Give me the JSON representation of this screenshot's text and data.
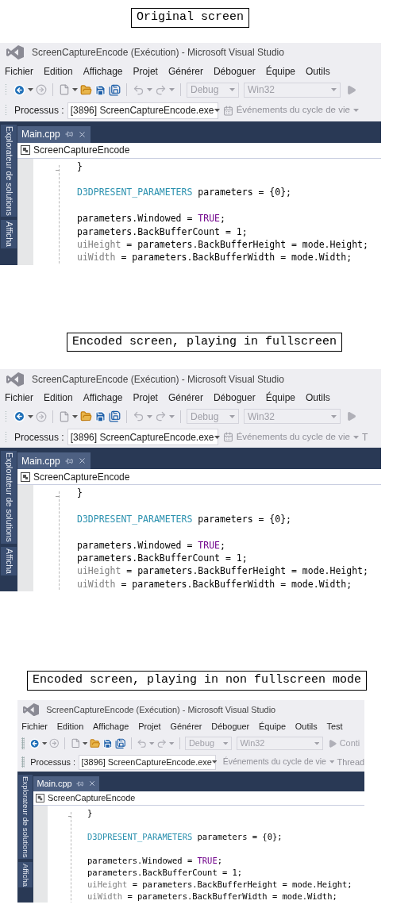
{
  "panels": [
    {
      "caption": "Original screen",
      "window_title": "ScreenCaptureEncode (Exécution) - Microsoft Visual Studio",
      "menu": [
        "Fichier",
        "Edition",
        "Affichage",
        "Projet",
        "Générer",
        "Déboguer",
        "Équipe",
        "Outils"
      ],
      "toolbar": {
        "configuration": "Debug",
        "platform": "Win32"
      },
      "process_label": "Processus :",
      "process": "[3896] ScreenCaptureEncode.exe",
      "lifecycle": "Événements du cycle de vie",
      "document_tab": "Main.cpp",
      "navigation": "ScreenCaptureEncode",
      "side_tabs": [
        "Explorateur de solutions",
        "Afficha"
      ],
      "code_blocks": [
        [
          [
            {
              "kind": "plain",
              "text": "}"
            }
          ]
        ],
        [
          [
            {
              "kind": "type",
              "text": "D3DPRESENT_PARAMETERS"
            },
            {
              "kind": "plain",
              "text": " parameters = {0};"
            }
          ]
        ],
        [
          [
            {
              "kind": "plain",
              "text": "parameters.Windowed = "
            },
            {
              "kind": "macro",
              "text": "TRUE"
            },
            {
              "kind": "plain",
              "text": ";"
            }
          ],
          [
            {
              "kind": "plain",
              "text": "parameters.BackBufferCount = 1;"
            }
          ],
          [
            {
              "kind": "global",
              "text": "uiHeight"
            },
            {
              "kind": "plain",
              "text": " = parameters.BackBufferHeight = mode.Height;"
            }
          ],
          [
            {
              "kind": "global",
              "text": "uiWidth"
            },
            {
              "kind": "plain",
              "text": " = parameters.BackBufferWidth = mode.Width;"
            }
          ]
        ]
      ]
    },
    {
      "caption": "Encoded screen, playing in fullscreen",
      "window_title": "ScreenCaptureEncode (Exécution) - Microsoft Visual Studio",
      "menu": [
        "Fichier",
        "Edition",
        "Affichage",
        "Projet",
        "Générer",
        "Déboguer",
        "Équipe",
        "Outils"
      ],
      "toolbar": {
        "configuration": "Debug",
        "platform": "Win32"
      },
      "process_label": "Processus :",
      "process": "[3896] ScreenCaptureEncode.exe",
      "lifecycle": "Événements du cycle de vie",
      "next_toolbar_item": "T",
      "document_tab": "Main.cpp",
      "navigation": "ScreenCaptureEncode",
      "side_tabs": [
        "Explorateur de solutions",
        "Afficha"
      ],
      "code_blocks": [
        [
          [
            {
              "kind": "plain",
              "text": "}"
            }
          ]
        ],
        [
          [
            {
              "kind": "type",
              "text": "D3DPRESENT_PARAMETERS"
            },
            {
              "kind": "plain",
              "text": " parameters = {0};"
            }
          ]
        ],
        [
          [
            {
              "kind": "plain",
              "text": "parameters.Windowed = "
            },
            {
              "kind": "macro",
              "text": "TRUE"
            },
            {
              "kind": "plain",
              "text": ";"
            }
          ],
          [
            {
              "kind": "plain",
              "text": "parameters.BackBufferCount = 1;"
            }
          ],
          [
            {
              "kind": "global",
              "text": "uiHeight"
            },
            {
              "kind": "plain",
              "text": " = parameters.BackBufferHeight = mode.Height;"
            }
          ],
          [
            {
              "kind": "global",
              "text": "uiWidth"
            },
            {
              "kind": "plain",
              "text": " = parameters.BackBufferWidth = mode.Width;"
            }
          ]
        ]
      ]
    },
    {
      "caption": "Encoded screen, playing in non fullscreen mode",
      "window_title": "ScreenCaptureEncode (Exécution) - Microsoft Visual Studio",
      "menu": [
        "Fichier",
        "Edition",
        "Affichage",
        "Projet",
        "Générer",
        "Déboguer",
        "Équipe",
        "Outils",
        "Test"
      ],
      "toolbar": {
        "configuration": "Debug",
        "platform": "Win32",
        "run_label": "Conti"
      },
      "process_label": "Processus :",
      "process": "[3896] ScreenCaptureEncode.exe",
      "lifecycle": "Événements du cycle de vie",
      "next_toolbar_item": "Thread",
      "document_tab": "Main.cpp",
      "navigation": "ScreenCaptureEncode",
      "side_tabs": [
        "Explorateur de solutions",
        "Afficha"
      ],
      "code_blocks": [
        [
          [
            {
              "kind": "plain",
              "text": "}"
            }
          ]
        ],
        [
          [
            {
              "kind": "type",
              "text": "D3DPRESENT_PARAMETERS"
            },
            {
              "kind": "plain",
              "text": " parameters = {0};"
            }
          ]
        ],
        [
          [
            {
              "kind": "plain",
              "text": "parameters.Windowed = "
            },
            {
              "kind": "macro",
              "text": "TRUE"
            },
            {
              "kind": "plain",
              "text": ";"
            }
          ],
          [
            {
              "kind": "plain",
              "text": "parameters.BackBufferCount = 1;"
            }
          ],
          [
            {
              "kind": "global",
              "text": "uiHeight"
            },
            {
              "kind": "plain",
              "text": " = parameters.BackBufferHeight = mode.Height;"
            }
          ],
          [
            {
              "kind": "global",
              "text": "uiWidth"
            },
            {
              "kind": "plain",
              "text": " = parameters.BackBufferWidth = mode.Width;"
            }
          ]
        ]
      ]
    }
  ]
}
